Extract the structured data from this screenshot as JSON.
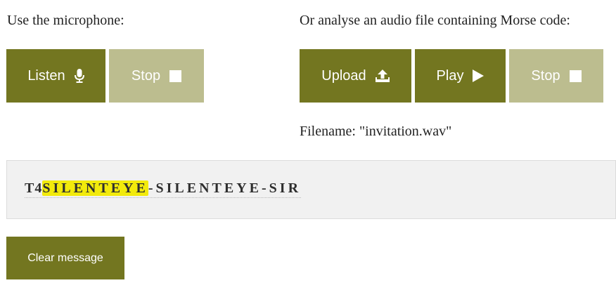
{
  "microphone": {
    "label": "Use the microphone:",
    "listen_label": "Listen",
    "stop_label": "Stop"
  },
  "file": {
    "label": "Or analyse an audio file containing Morse code:",
    "upload_label": "Upload",
    "play_label": "Play",
    "stop_label": "Stop",
    "filename_text": "Filename: \"invitation.wav\""
  },
  "message": {
    "prefix": "T4",
    "highlighted": "SILENTEYE",
    "rest": "-SILENTEYE-SIR"
  },
  "clear_label": "Clear message",
  "colors": {
    "primary": "#737620",
    "disabled": "#bcbd8f",
    "highlight": "#f2ea0c"
  },
  "icons": {
    "listen": "microphone-icon",
    "stop": "stop-icon",
    "upload": "upload-icon",
    "play": "play-icon"
  }
}
